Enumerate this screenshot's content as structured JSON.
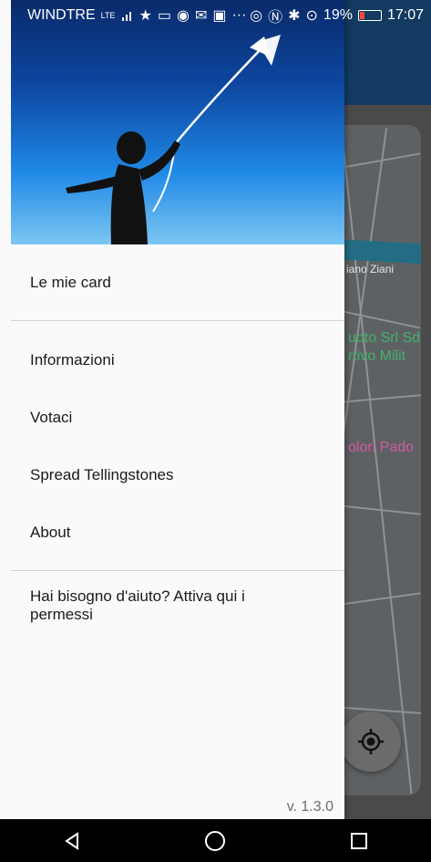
{
  "status_bar": {
    "carrier": "WINDTRE",
    "signal": "LTE",
    "icons_left": [
      "star-icon",
      "screen-icon",
      "chrome-icon",
      "mail-icon",
      "gallery-icon",
      "more-icon"
    ],
    "icons_right": [
      "eye-icon",
      "nfc-icon",
      "bluetooth-icon",
      "location-icon"
    ],
    "battery": "19%",
    "battery_level": 0.19,
    "time": "17:07"
  },
  "drawer": {
    "menu": [
      {
        "label": "Le mie card"
      },
      {
        "label": "Informazioni"
      },
      {
        "label": "Votaci"
      },
      {
        "label": "Spread Tellingstones"
      },
      {
        "label": "About"
      }
    ],
    "help": "Hai bisogno d'aiuto? Attiva qui i permessi",
    "version": "v. 1.3.0"
  },
  "map": {
    "labels": [
      {
        "text": "iano Ziani",
        "color": "#e8e8e8"
      },
      {
        "text": "uoto Srl Sd",
        "color": "#3fb36b"
      },
      {
        "text": "rtivo Milit",
        "color": "#3fb36b"
      },
      {
        "text": "olori Pado",
        "color": "#d05aa0"
      }
    ]
  },
  "colors": {
    "app_bar": "#133b61",
    "drawer_bg": "#fafafa",
    "battery_low": "#ff4a3c"
  }
}
